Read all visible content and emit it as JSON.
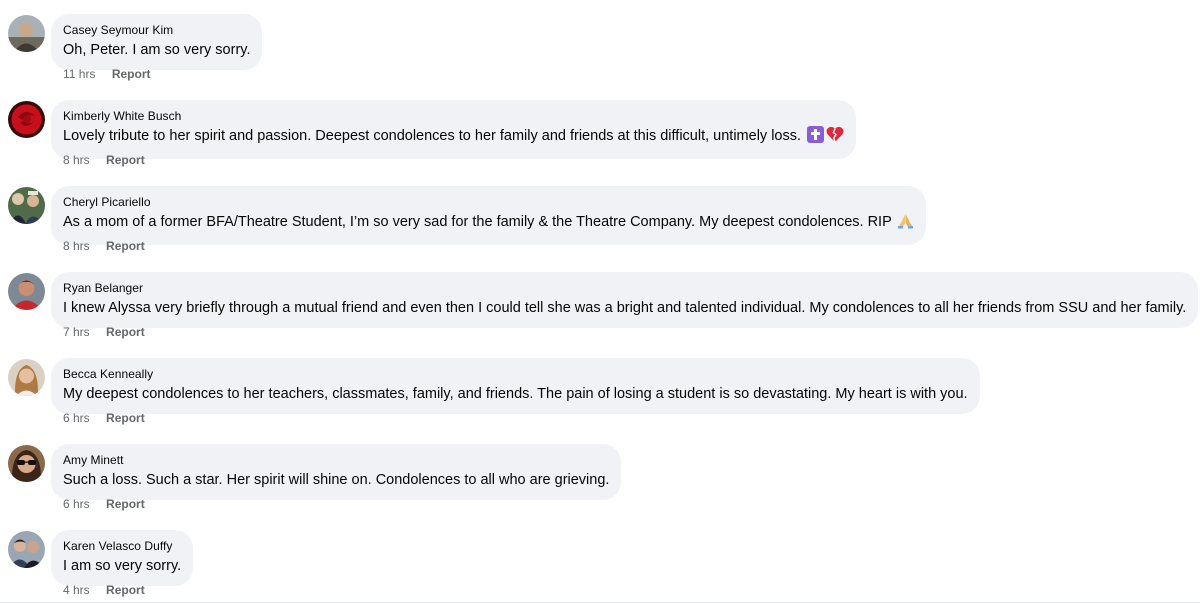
{
  "comments": [
    {
      "author": "Casey Seymour Kim",
      "text": "Oh, Peter. I am so very sorry.",
      "time": "11 hrs",
      "report_label": "Report",
      "avatar_icon": "person-photo-icon",
      "emoji": []
    },
    {
      "author": "Kimberly White Busch",
      "text": "Lovely tribute to her spirit and passion. Deepest condolences to her family and friends at this difficult, untimely loss.",
      "time": "8 hrs",
      "report_label": "Report",
      "avatar_icon": "red-rose-photo-icon",
      "emoji": [
        "latin-cross-icon",
        "broken-heart-icon"
      ]
    },
    {
      "author": "Cheryl Picariello",
      "text": "As a mom of a former BFA/Theatre Student, I’m so very sad for the family & the Theatre Company. My deepest condolences. RIP",
      "time": "8 hrs",
      "report_label": "Report",
      "avatar_icon": "person-photo-icon",
      "emoji": [
        "folded-hands-icon"
      ]
    },
    {
      "author": "Ryan Belanger",
      "text": "I knew Alyssa very briefly through a mutual friend and even then I could tell she was a bright and talented individual. My condolences to all her friends from SSU and her family.",
      "time": "7 hrs",
      "report_label": "Report",
      "avatar_icon": "person-photo-icon",
      "emoji": []
    },
    {
      "author": "Becca Kenneally",
      "text": "My deepest condolences to her teachers, classmates, family, and friends. The pain of losing a student is so devastating. My heart is with you.",
      "time": "6 hrs",
      "report_label": "Report",
      "avatar_icon": "person-photo-icon",
      "emoji": []
    },
    {
      "author": "Amy Minett",
      "text": "Such a loss. Such a star. Her spirit will shine on. Condolences to all who are grieving.",
      "time": "6 hrs",
      "report_label": "Report",
      "avatar_icon": "person-with-sunglasses-photo-icon",
      "emoji": []
    },
    {
      "author": "Karen Velasco Duffy",
      "text": "I am so very sorry.",
      "time": "4 hrs",
      "report_label": "Report",
      "avatar_icon": "person-photo-icon",
      "emoji": []
    }
  ],
  "colors": {
    "bubble_background": "#f0f2f5",
    "secondary_text": "#65676b",
    "primary_text": "#050505",
    "divider": "#e4e6eb"
  }
}
